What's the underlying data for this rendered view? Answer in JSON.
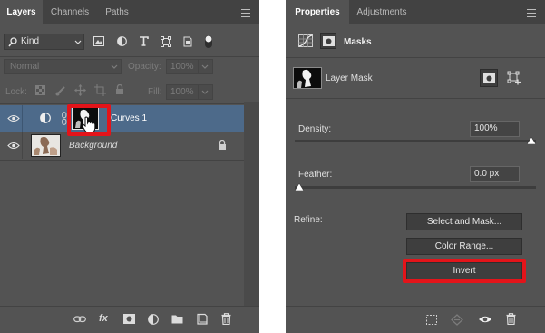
{
  "layers_panel": {
    "tabs": [
      "Layers",
      "Channels",
      "Paths"
    ],
    "filter": {
      "label": "Kind"
    },
    "blend_mode": "Normal",
    "opacity_label": "Opacity:",
    "opacity_value": "100%",
    "lock_label": "Lock:",
    "fill_label": "Fill:",
    "fill_value": "100%",
    "layers": [
      {
        "name": "Curves 1",
        "selected": true
      },
      {
        "name": "Background",
        "selected": false
      }
    ],
    "bottom_icons": [
      "link-icon",
      "fx-icon",
      "add-mask-icon",
      "adjustment-icon",
      "folder-icon",
      "new-layer-icon",
      "trash-icon"
    ],
    "fx_label": "fx"
  },
  "properties_panel": {
    "tabs": [
      "Properties",
      "Adjustments"
    ],
    "section_title": "Masks",
    "mask_type": "Layer Mask",
    "density_label": "Density:",
    "density_value": "100%",
    "density_level": 1.0,
    "feather_label": "Feather:",
    "feather_value": "0.0 px",
    "feather_level": 0.0,
    "refine_label": "Refine:",
    "buttons": {
      "select_and_mask": "Select and Mask...",
      "color_range": "Color Range...",
      "invert": "Invert"
    }
  },
  "colors": {
    "panel_bg": "#535353",
    "tabbar_bg": "#424242",
    "selected_layer": "#4d6a8a",
    "highlight_red": "#e3141a"
  }
}
